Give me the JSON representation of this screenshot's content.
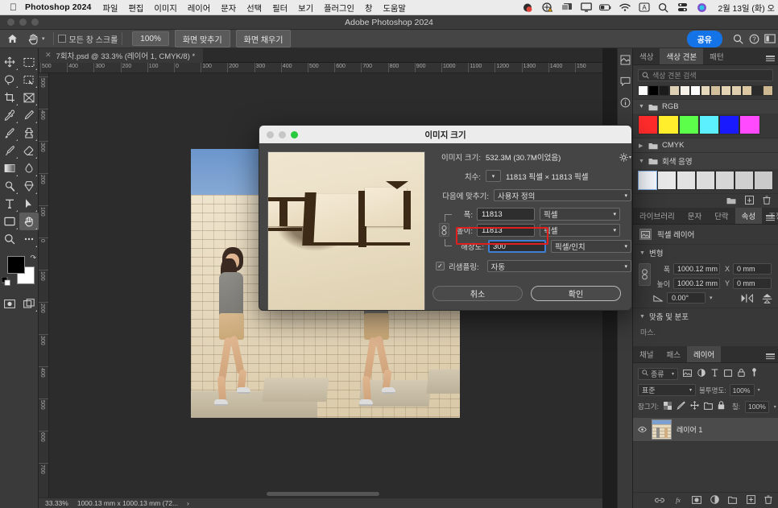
{
  "macbar": {
    "apple_icon": "apple-logo-icon",
    "app_name": "Photoshop 2024",
    "menus": [
      "파일",
      "편집",
      "이미지",
      "레이어",
      "문자",
      "선택",
      "필터",
      "보기",
      "플러그인",
      "창",
      "도움말"
    ],
    "tray_icons": [
      "record-icon",
      "location-warning-icon",
      "screen-mirroring-icon",
      "display-icon",
      "battery-icon",
      "wifi-icon",
      "input-source-icon",
      "spotlight-search-icon",
      "control-center-icon",
      "siri-icon"
    ],
    "clock": "2월 13일 (화) 오"
  },
  "window": {
    "title": "Adobe Photoshop 2024"
  },
  "options_bar": {
    "home_icon": "home-icon",
    "tool_icon": "hand-tool-icon",
    "scroll_all_windows_label": "모든 창 스크롤",
    "buttons": [
      "100%",
      "화면 맞추기",
      "화면 채우기"
    ],
    "share_label": "공유",
    "right_icons": [
      "search-icon",
      "help-icon",
      "workspace-icon"
    ]
  },
  "document_tab": {
    "label": "7회차.psd @ 33.3% (레이어 1, CMYK/8) *",
    "close_icon": "close-icon"
  },
  "toolbar": {
    "tools": [
      "move-tool-icon",
      "rectangular-marquee-tool-icon",
      "lasso-tool-icon",
      "object-selection-tool-icon",
      "crop-tool-icon",
      "frame-tool-icon",
      "eyedropper-tool-icon",
      "spot-healing-brush-tool-icon",
      "brush-tool-icon",
      "clone-stamp-tool-icon",
      "history-brush-tool-icon",
      "eraser-tool-icon",
      "gradient-tool-icon",
      "blur-tool-icon",
      "dodge-tool-icon",
      "pen-tool-icon",
      "type-tool-icon",
      "path-selection-tool-icon",
      "shape-tool-icon",
      "hand-tool-icon",
      "zoom-tool-icon",
      "edit-toolbar-icon"
    ],
    "selected_tool": "hand-tool-icon",
    "foreground_color": "#000000",
    "background_color": "#ffffff",
    "swap_icon": "swap-colors-icon",
    "default_icon": "default-colors-icon",
    "quickmask_icon": "quick-mask-icon",
    "screenmode_icon": "screen-mode-icon"
  },
  "rulers": {
    "horizontal": [
      "500",
      "400",
      "300",
      "200",
      "100",
      "0",
      "100",
      "200",
      "300",
      "400",
      "500",
      "600",
      "700",
      "800",
      "900",
      "1000",
      "1100",
      "1200",
      "1300",
      "1400",
      "150"
    ],
    "vertical": [
      "500",
      "400",
      "300",
      "200",
      "100",
      "0",
      "100",
      "200",
      "300",
      "400",
      "500",
      "600",
      "700"
    ]
  },
  "dialog": {
    "title": "이미지 크기",
    "traffic_lights": [
      "#c6c6c6",
      "#c6c6c6",
      "#2ac940"
    ],
    "image_size_label": "이미지 크기:",
    "image_size_value": "532.3M (30.7M이었음)",
    "gear_icon": "gear-icon",
    "dimensions_label": "치수:",
    "dimensions_value": "11813 픽셀  ×  11813 픽셀",
    "fit_to_label": "다음에 맞추기:",
    "fit_to_value": "사용자 정의",
    "width_label": "폭:",
    "width_value": "11813",
    "width_unit": "픽셀",
    "height_label": "높이:",
    "height_value": "11813",
    "height_unit": "픽셀",
    "resolution_label": "해상도:",
    "resolution_value": "300",
    "resolution_unit": "픽셀/인치",
    "resample_label": "리샘플링:",
    "resample_value": "자동",
    "resample_checked": "✓",
    "link_icon": "link-constrain-icon",
    "cancel_label": "취소",
    "ok_label": "확인",
    "highlight_color": "#e01f1f"
  },
  "swatches_panel": {
    "tabs": [
      "색상",
      "색상 견본",
      "패턴"
    ],
    "active_tab": "색상 견본",
    "menu_icon": "panel-menu-icon",
    "search_icon": "search-icon",
    "search_placeholder": "색상 견본 검색",
    "recent_swatches": [
      "#ffffff",
      "#000000",
      "#1b1b1b",
      "#ded0b4",
      "#f7f3ea",
      "#fdfdfd",
      "#e6d8bb",
      "#d2bf9b",
      "#e4d4b3",
      "#e0cfae",
      "#dcc9a4",
      "#2a2a2a",
      "#cdb892"
    ],
    "groups": [
      {
        "name": "RGB",
        "expanded": true,
        "colors": [
          "#ff2b2b",
          "#ffee2b",
          "#5cff4a",
          "#5cf0ff",
          "#1a1aff",
          "#ff4aff"
        ]
      },
      {
        "name": "CMYK",
        "expanded": false,
        "colors": []
      },
      {
        "name": "회색 음영",
        "expanded": true,
        "colors": [
          "#f2f6fb",
          "#e8e8e8",
          "#e2e2e2",
          "#dcdcdc",
          "#d6d6d6",
          "#d0d0d0",
          "#cacaca"
        ]
      }
    ],
    "footer_icons": [
      "new-group-icon",
      "new-swatch-icon",
      "delete-icon"
    ]
  },
  "properties_panel": {
    "tabs": [
      "라이브러리",
      "문자",
      "단락",
      "속성",
      "조정"
    ],
    "active_tab": "속성",
    "menu_icon": "panel-menu-icon",
    "layer_type_icon": "pixel-layer-icon",
    "layer_type_label": "픽셀 레이어",
    "transform_section": "변형",
    "width_label": "폭",
    "width_value": "1000.12 mm",
    "x_label": "X",
    "x_value": "0 mm",
    "height_label": "높이",
    "height_value": "1000.12 mm",
    "y_label": "Y",
    "y_value": "0 mm",
    "angle_icon": "angle-icon",
    "angle_value": "0.00°",
    "flip_h_icon": "flip-horizontal-icon",
    "flip_v_icon": "flip-vertical-icon",
    "link_icon": "link-constrain-icon",
    "align_section": "맞춤 및 분포",
    "align_more": "마스."
  },
  "layers_panel": {
    "tabs": [
      "채널",
      "패스",
      "레이어"
    ],
    "active_tab": "레이어",
    "menu_icon": "panel-menu-icon",
    "filter_label": "종류",
    "filter_icons": [
      "filter-pixel-icon",
      "filter-adjustment-icon",
      "filter-type-icon",
      "filter-shape-icon",
      "filter-smart-icon",
      "filter-toggle-icon"
    ],
    "blend_mode": "표준",
    "opacity_label": "불투명도:",
    "opacity_value": "100%",
    "lock_label": "잠그기:",
    "lock_icons": [
      "lock-transparency-icon",
      "lock-image-icon",
      "lock-position-icon",
      "lock-artboard-icon",
      "lock-all-icon"
    ],
    "fill_label": "칠:",
    "fill_value": "100%",
    "layers": [
      {
        "name": "레이어 1",
        "visible": true,
        "selected": true,
        "eye_icon": "eye-icon"
      }
    ],
    "footer_icons": [
      "link-layers-icon",
      "fx-icon",
      "mask-icon",
      "adjustment-icon",
      "new-group-icon",
      "new-layer-icon",
      "delete-layer-icon"
    ]
  },
  "rail_icons": [
    "color-picker-rail-icon",
    "comment-rail-icon",
    "info-rail-icon"
  ],
  "status_bar": {
    "zoom": "33.33%",
    "doc_info": "1000.13 mm x 1000.13 mm (72...",
    "chevron": "›"
  }
}
